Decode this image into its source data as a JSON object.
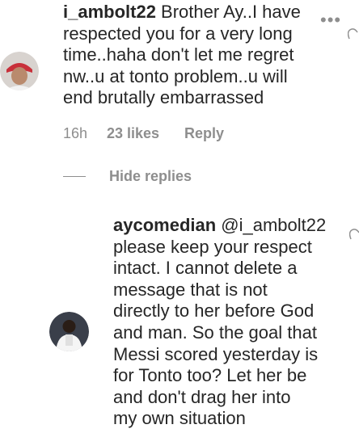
{
  "comment": {
    "username": "i_ambolt22",
    "text": " Brother Ay..I have\nrespected you for a very long\ntime..haha don't let me regret\nnw..u at tonto problem..u will\nend brutally embarrassed",
    "time": "16h",
    "likes": "23 likes",
    "reply_label": "Reply",
    "more_icon": "•••"
  },
  "hide_replies_label": "Hide replies",
  "reply": {
    "username": "aycomedian",
    "text": " @i_ambolt22\nplease keep your respect\nintact. I cannot delete a\nmessage that is not\ndirectly to her before God\nand man. So the goal that\nMessi scored yesterday is\nfor Tonto too? Let her be\nand don't drag her into\nmy own situation"
  },
  "colors": {
    "text": "#262626",
    "muted": "#8e8e8e"
  }
}
